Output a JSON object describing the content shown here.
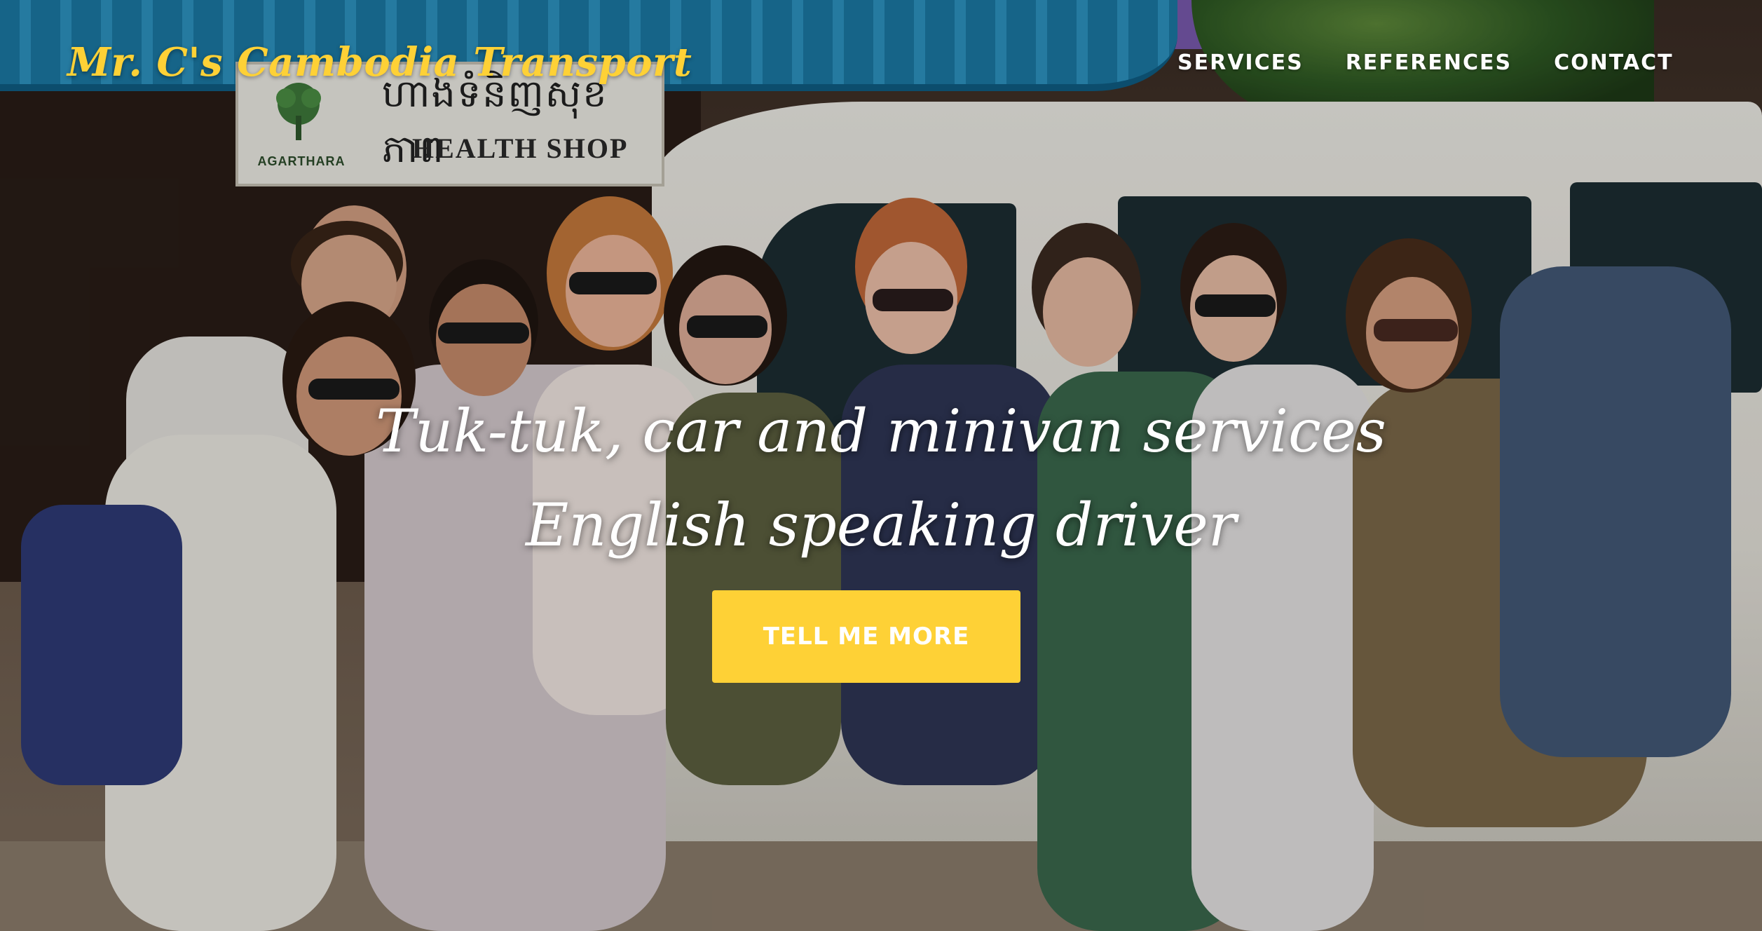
{
  "brand": {
    "name": "Mr. C's Cambodia Transport"
  },
  "nav": {
    "items": [
      "SERVICES",
      "REFERENCES",
      "CONTACT"
    ]
  },
  "hero": {
    "heading_line1": "Tuk-tuk, car and minivan services",
    "heading_line2": "English speaking driver",
    "cta_label": "TELL ME MORE"
  },
  "background_photo": {
    "sign_khmer": "ហាងទំនិញសុខភាព",
    "sign_text": "HEALTH SHOP",
    "sign_brand": "AGARTHARA"
  },
  "colors": {
    "accent": "#fed136",
    "nav_text": "#ffffff"
  }
}
